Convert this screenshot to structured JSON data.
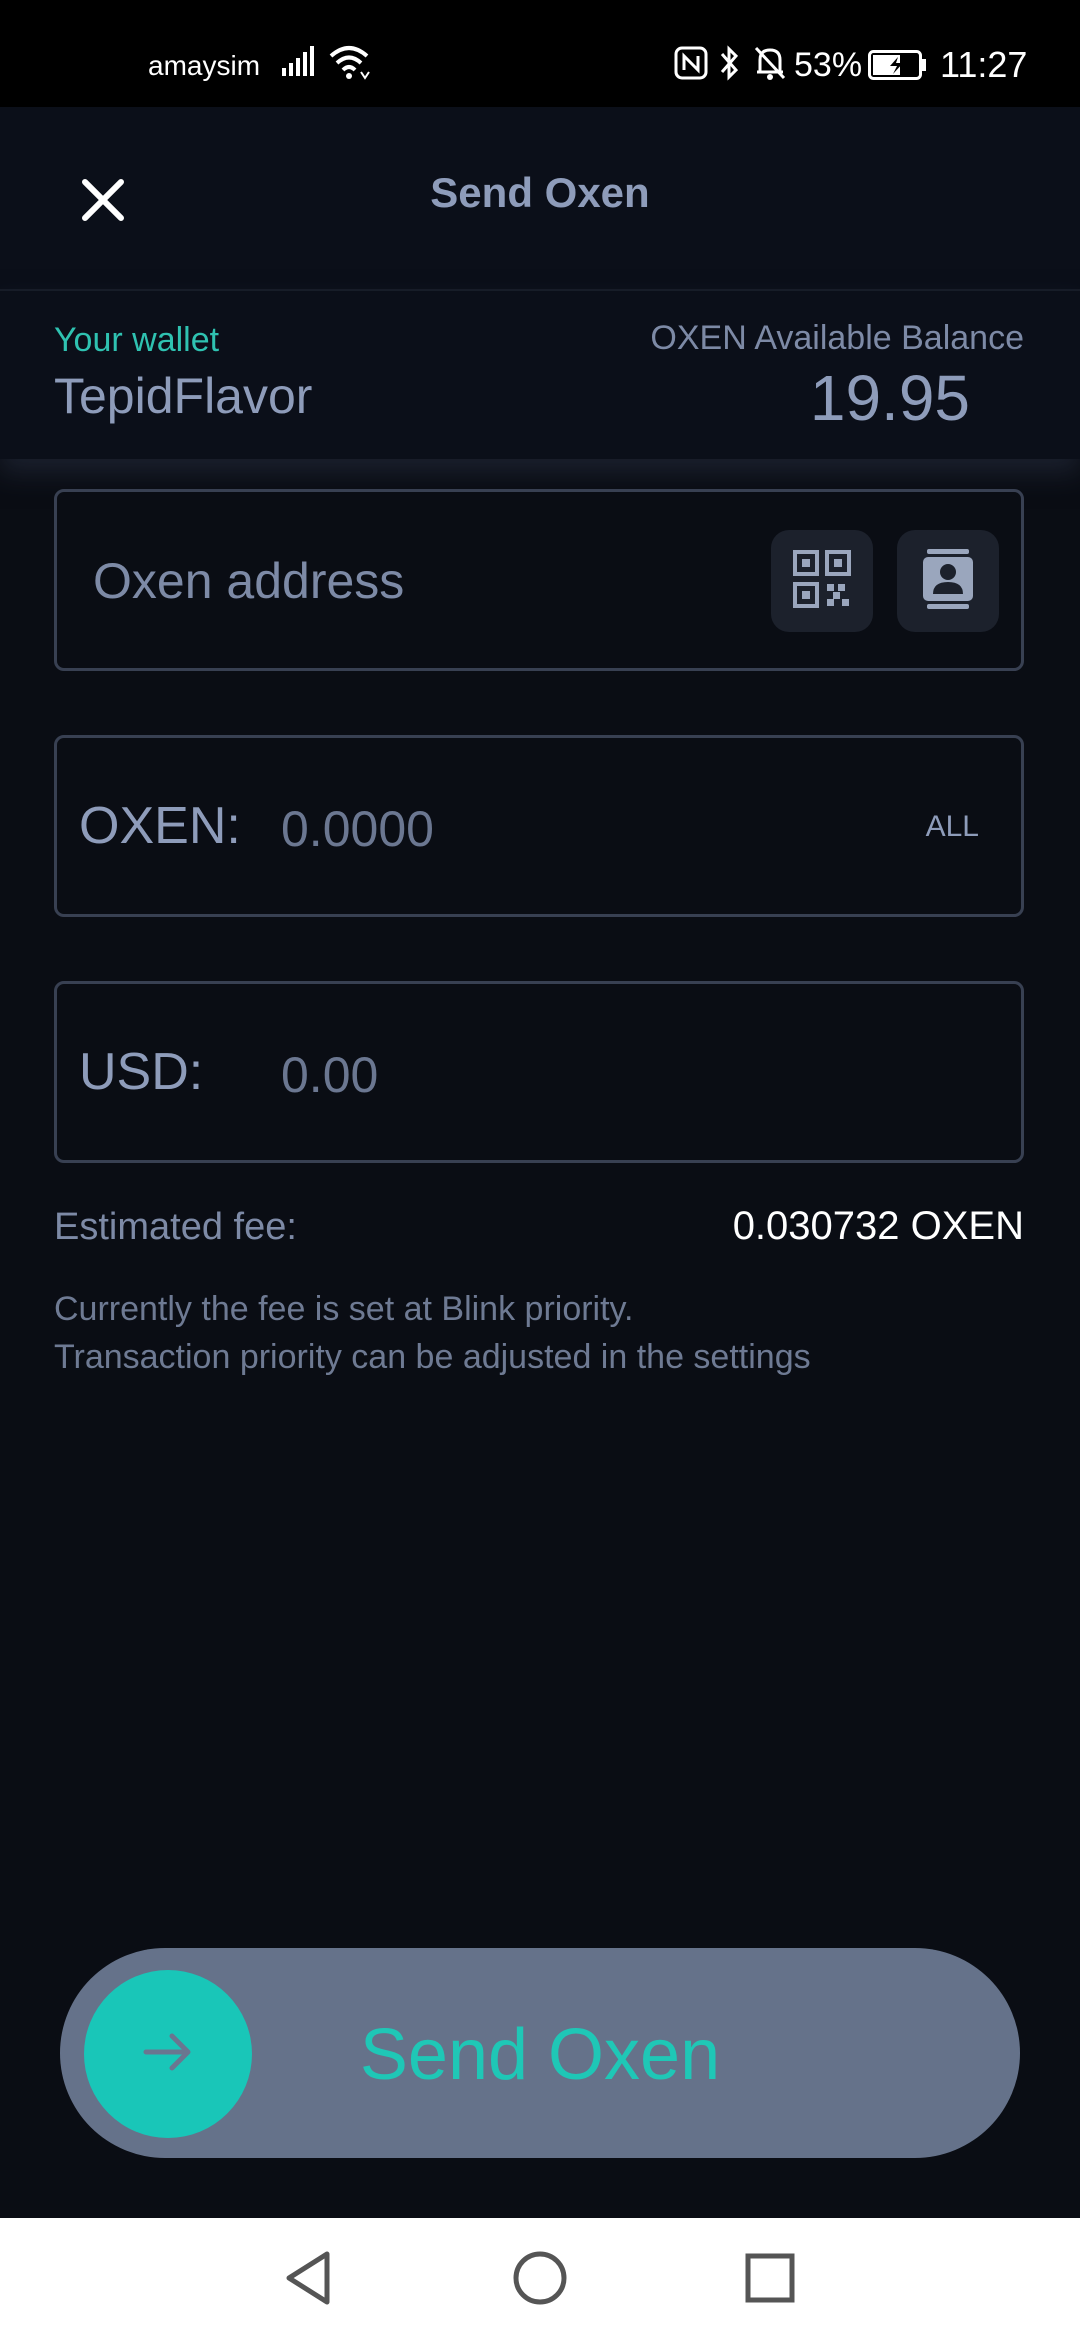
{
  "status_bar": {
    "carrier": "amaysim",
    "battery_percent": "53%",
    "time": "11:27",
    "icons": [
      "signal-icon",
      "wifi-icon",
      "nfc-icon",
      "bluetooth-icon",
      "mute-icon",
      "battery-icon"
    ]
  },
  "header": {
    "title": "Send Oxen",
    "close_icon": "close-icon"
  },
  "wallet": {
    "label": "Your wallet",
    "name": "TepidFlavor",
    "balance_label": "OXEN Available Balance",
    "balance_value": "19.95"
  },
  "address_field": {
    "placeholder": "Oxen address",
    "value": "",
    "qr_icon": "qr-code-icon",
    "contacts_icon": "contacts-icon"
  },
  "oxen_field": {
    "prefix": "OXEN:",
    "placeholder": "0.0000",
    "value": "",
    "all_label": "ALL"
  },
  "usd_field": {
    "prefix": "USD:",
    "placeholder": "0.00",
    "value": ""
  },
  "fee": {
    "label": "Estimated fee:",
    "value": "0.030732 OXEN",
    "note_line1": "Currently the fee is set at Blink priority.",
    "note_line2": "Transaction priority can be adjusted in the settings"
  },
  "send_slider": {
    "label": "Send Oxen",
    "knob_icon": "arrow-right-icon"
  },
  "nav_bar": {
    "icons": [
      "back-icon",
      "home-icon",
      "recent-apps-icon"
    ]
  },
  "colors": {
    "background": "#0a0d14",
    "accent": "#19c6b8",
    "text_muted": "#8e9cba",
    "slider_track": "#65728a"
  }
}
